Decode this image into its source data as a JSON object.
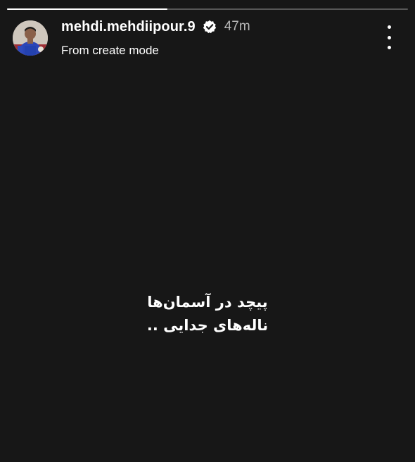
{
  "story": {
    "progress_fraction": 0.4,
    "user": {
      "username": "mehdi.mehdiipour.9",
      "time_ago": "47m",
      "subtitle": "From create mode",
      "verified_icon": "verified-badge-icon",
      "avatar": "avatar"
    },
    "caption": {
      "line1": "پیچد در آسمان‌ها",
      "line2": "ناله‌های جدایی .."
    },
    "more_icon": "more-vertical-icon",
    "colors": {
      "background": "#171717",
      "text": "#ffffff",
      "time_text": "#b8b8b8",
      "progress_track": "rgba(255,255,255,0.28)",
      "progress_fill": "#ffffff"
    }
  }
}
